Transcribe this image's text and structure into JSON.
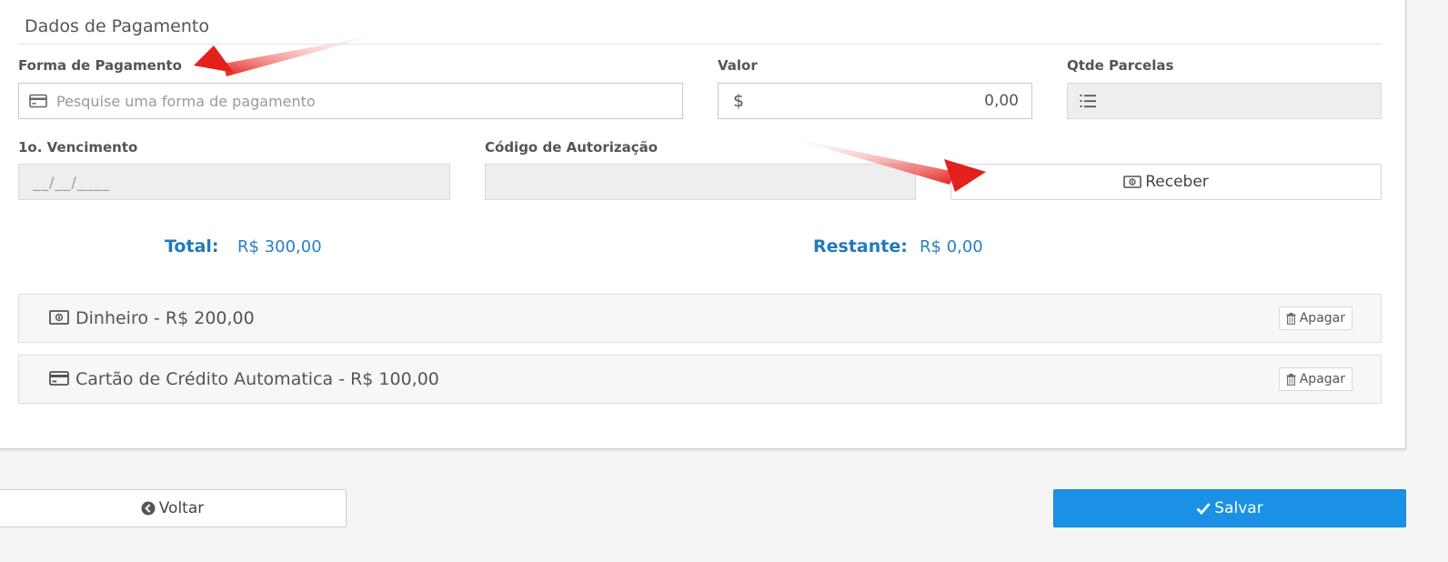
{
  "section": {
    "title": "Dados de Pagamento"
  },
  "form": {
    "forma_label": "Forma de Pagamento",
    "forma_placeholder": "Pesquise uma forma de pagamento",
    "valor_label": "Valor",
    "valor_prefix": "$",
    "valor_value": "0,00",
    "parcelas_label": "Qtde Parcelas",
    "vencimento_label": "1o. Vencimento",
    "vencimento_placeholder": "__/__/____",
    "autorizacao_label": "Código de Autorização",
    "receber_label": "Receber"
  },
  "summary": {
    "total_label": "Total:",
    "total_value": "R$ 300,00",
    "restante_label": "Restante:",
    "restante_value": "R$ 0,00"
  },
  "payments": [
    {
      "text": "Dinheiro - R$ 200,00",
      "icon": "money-icon",
      "delete_label": "Apagar"
    },
    {
      "text": "Cartão de Crédito Automatica - R$ 100,00",
      "icon": "credit-card-icon",
      "delete_label": "Apagar"
    }
  ],
  "footer": {
    "back_label": "Voltar",
    "save_label": "Salvar"
  },
  "colors": {
    "accent": "#1a91e6",
    "summary_text": "#2279b9",
    "annotation_arrow": "#e3201b"
  }
}
